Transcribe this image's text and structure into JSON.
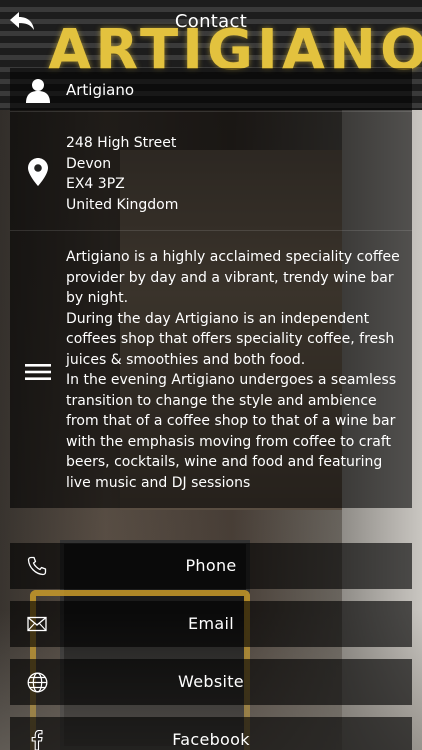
{
  "header": {
    "title": "Contact",
    "back_icon": "back-arrow-icon"
  },
  "business": {
    "name": "Artigiano",
    "name_icon": "person-icon",
    "address_icon": "location-pin-icon",
    "address_lines": [
      "248 High Street",
      "Devon",
      "EX4 3PZ",
      "United Kingdom"
    ],
    "description_icon": "menu-lines-icon",
    "description": [
      "Artigiano is a highly acclaimed speciality coffee provider by day and a vibrant, trendy wine bar by night.",
      "During the day Artigiano is an independent coffees shop that offers speciality coffee, fresh juices & smoothies and both food.",
      "In the evening Artigiano undergoes a seamless transition to change the style and ambience from that of a coffee shop to that of a wine bar with the emphasis moving from coffee to craft beers, cocktails, wine and food and featuring live music and DJ sessions"
    ]
  },
  "background": {
    "sign_text": "ARTIGIANO"
  },
  "actions": {
    "phone": {
      "label": "Phone",
      "icon": "phone-icon"
    },
    "email": {
      "label": "Email",
      "icon": "envelope-icon"
    },
    "website": {
      "label": "Website",
      "icon": "globe-icon"
    },
    "facebook": {
      "label": "Facebook",
      "icon": "facebook-icon"
    }
  },
  "colors": {
    "panel_bg": "#000000",
    "text": "#ffffff",
    "sign": "#e3c23e"
  }
}
